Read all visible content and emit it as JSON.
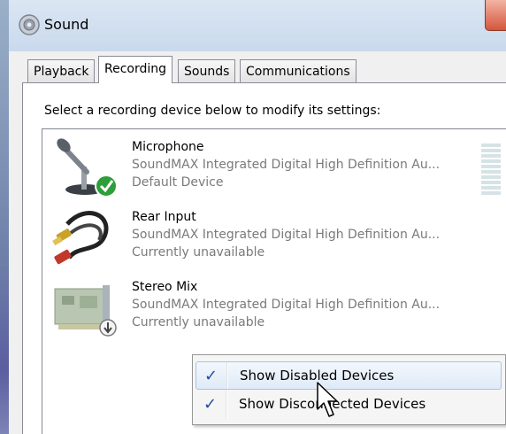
{
  "window": {
    "title": "Sound",
    "icon": "speaker-icon"
  },
  "tabs": [
    {
      "label": "Playback",
      "active": false
    },
    {
      "label": "Recording",
      "active": true
    },
    {
      "label": "Sounds",
      "active": false
    },
    {
      "label": "Communications",
      "active": false
    }
  ],
  "instruction": "Select a recording device below to modify its settings:",
  "devices": [
    {
      "name": "Microphone",
      "description": "SoundMAX Integrated Digital High Definition Au...",
      "status": "Default Device",
      "icon": "microphone-icon",
      "default": true
    },
    {
      "name": "Rear Input",
      "description": "SoundMAX Integrated Digital High Definition Au...",
      "status": "Currently unavailable",
      "icon": "audio-cable-icon"
    },
    {
      "name": "Stereo Mix",
      "description": "SoundMAX Integrated Digital High Definition Au...",
      "status": "Currently unavailable",
      "icon": "sound-card-icon"
    }
  ],
  "context_menu": {
    "items": [
      {
        "label": "Show Disabled Devices",
        "checked": true
      },
      {
        "label": "Show Disconnected Devices",
        "checked": true
      }
    ]
  },
  "colors": {
    "check": "#1e4f9f",
    "default_badge": "#2e9e3a",
    "secondary_text": "#7a7a7a"
  }
}
